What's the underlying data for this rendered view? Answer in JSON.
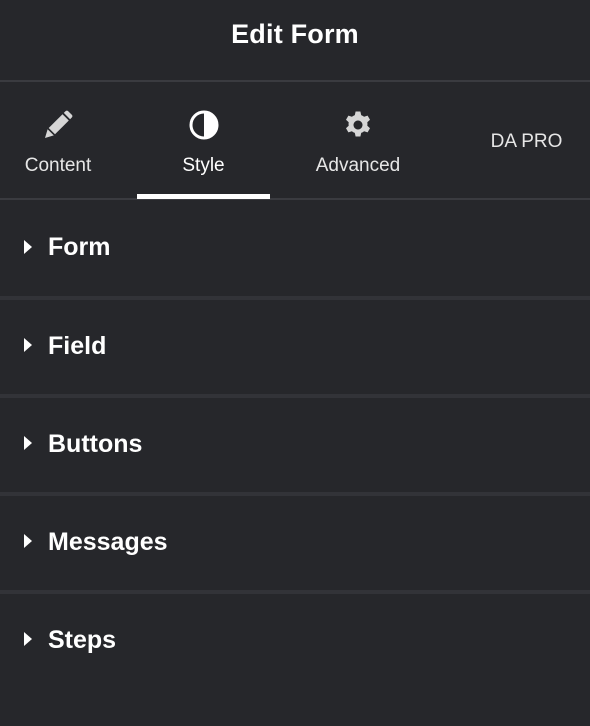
{
  "header": {
    "title": "Edit Form"
  },
  "tabs": [
    {
      "label": "Content",
      "icon": "pencil-icon",
      "active": false
    },
    {
      "label": "Style",
      "icon": "half-circle-contrast-icon",
      "active": true
    },
    {
      "label": "Advanced",
      "icon": "gear-icon",
      "active": false
    },
    {
      "label": "DA PRO",
      "icon": "",
      "active": false
    }
  ],
  "sections": [
    {
      "label": "Form",
      "icon": "caret-right-icon"
    },
    {
      "label": "Field",
      "icon": "caret-right-icon"
    },
    {
      "label": "Buttons",
      "icon": "caret-right-icon"
    },
    {
      "label": "Messages",
      "icon": "caret-right-icon"
    },
    {
      "label": "Steps",
      "icon": "caret-right-icon"
    }
  ],
  "colors": {
    "background": "#26272b",
    "divider": "#3a3b40",
    "text": "#ffffff",
    "icon": "#d6d6d6"
  }
}
